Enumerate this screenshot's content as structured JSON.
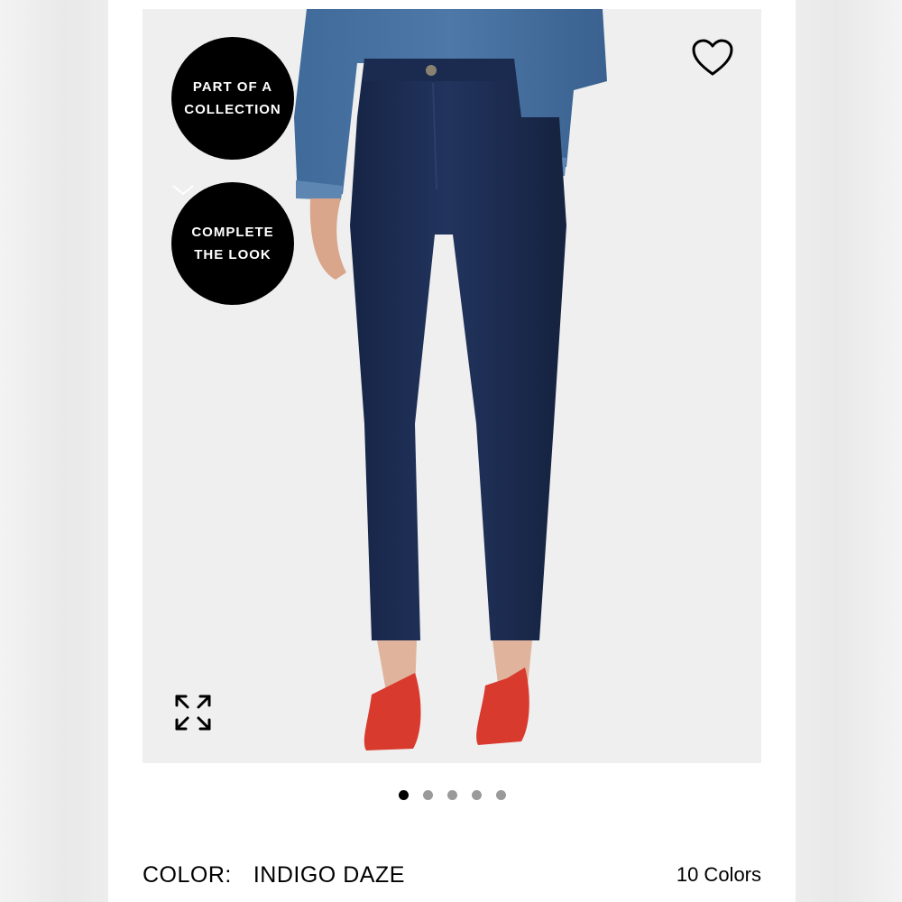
{
  "badges": {
    "collection_line1": "PART OF A",
    "collection_line2": "COLLECTION",
    "complete_line1": "COMPLETE",
    "complete_line2": "THE LOOK"
  },
  "icons": {
    "wishlist": "heart-outline-icon",
    "expand": "expand-arrows-icon",
    "chevron": "chevron-down-icon"
  },
  "carousel": {
    "total": 5,
    "active_index": 0
  },
  "color": {
    "label": "COLOR:",
    "value": "INDIGO DAZE",
    "count": "10 Colors"
  },
  "colors": {
    "badge_bg": "#000000",
    "denim": "#1f2f55",
    "shoe": "#d93a2e"
  }
}
